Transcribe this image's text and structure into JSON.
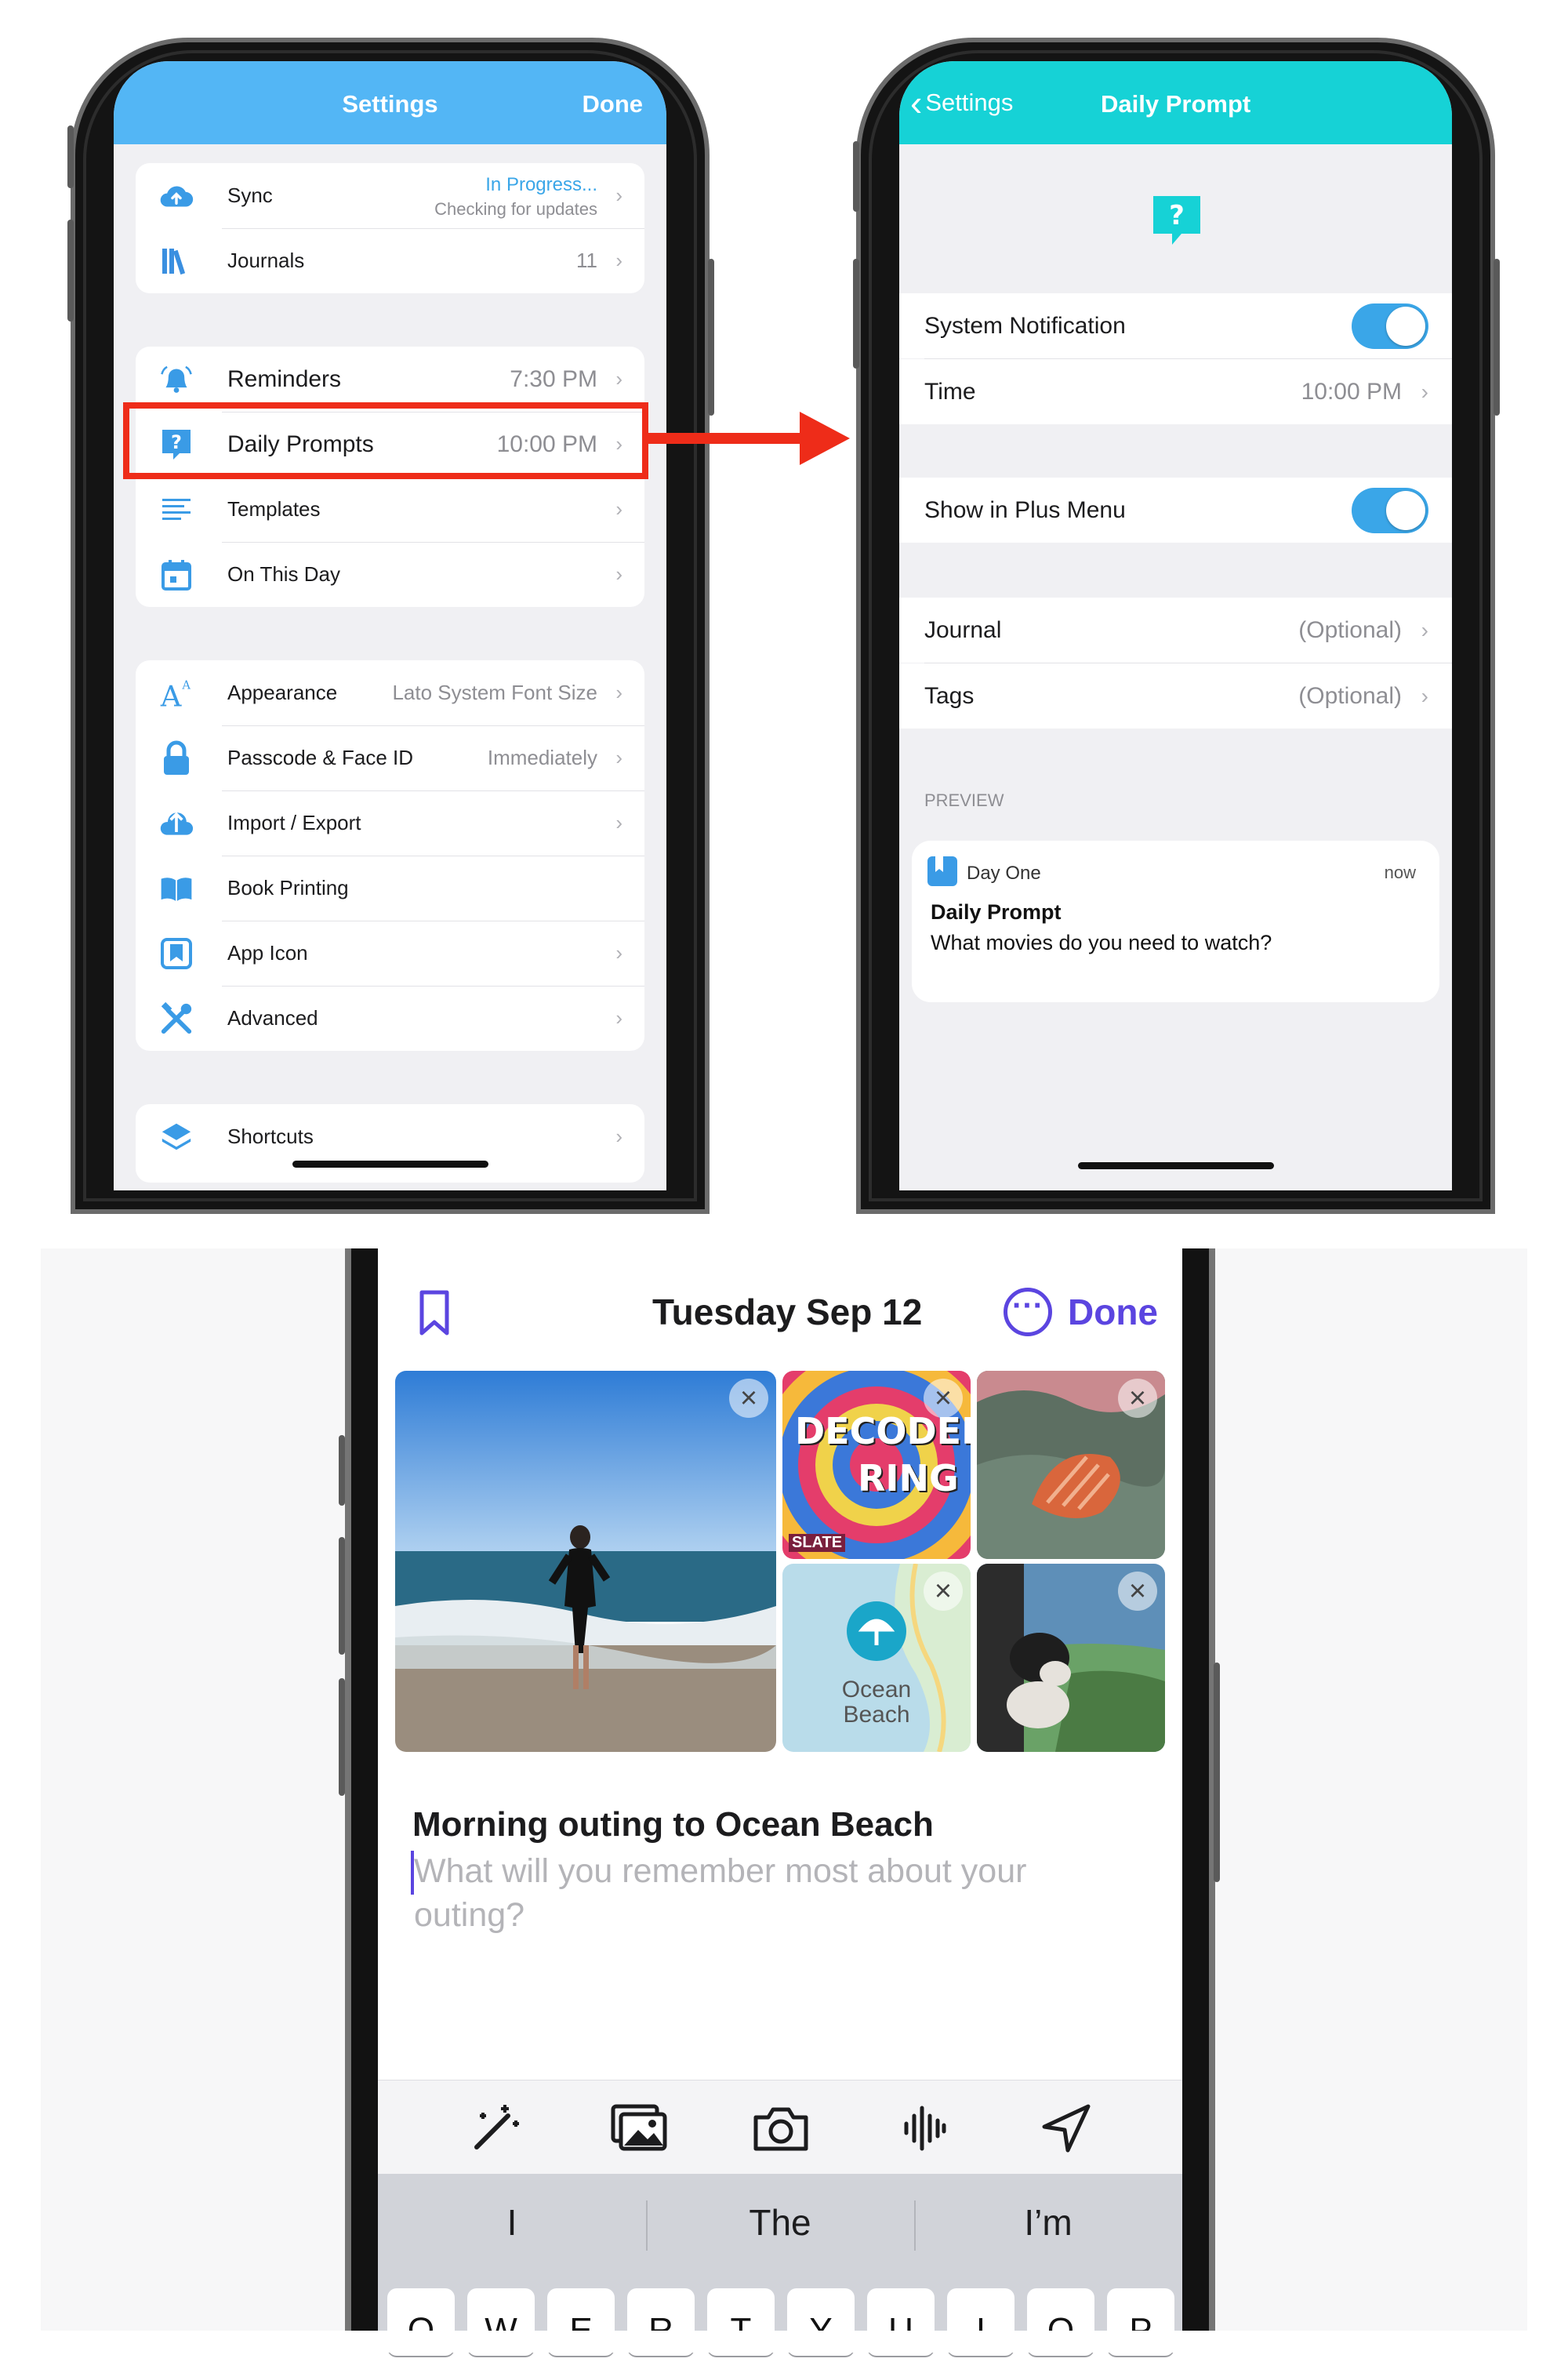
{
  "colors": {
    "settings_header": "#53b6f5",
    "prompt_header": "#16d2d6",
    "highlight": "#ee2c19",
    "toggle": "#3aa6e8",
    "accent_purple": "#5b45e0"
  },
  "settings_screen": {
    "title": "Settings",
    "done": "Done",
    "group1": [
      {
        "icon": "cloud-upload-icon",
        "label": "Sync",
        "status": "In Progress...",
        "detail": "Checking for updates"
      },
      {
        "icon": "books-icon",
        "label": "Journals",
        "value": "11"
      }
    ],
    "group2": [
      {
        "icon": "bell-icon",
        "label": "Reminders",
        "value": "7:30 PM"
      },
      {
        "icon": "question-bubble-icon",
        "label": "Daily Prompts",
        "value": "10:00 PM"
      },
      {
        "icon": "lines-icon",
        "label": "Templates",
        "value": ""
      },
      {
        "icon": "calendar-icon",
        "label": "On This Day",
        "value": ""
      }
    ],
    "group3": [
      {
        "icon": "font-size-icon",
        "label": "Appearance",
        "value": "Lato System Font Size"
      },
      {
        "icon": "lock-icon",
        "label": "Passcode & Face ID",
        "value": "Immediately"
      },
      {
        "icon": "import-export-icon",
        "label": "Import / Export",
        "value": ""
      },
      {
        "icon": "book-icon",
        "label": "Book Printing",
        "value": ""
      },
      {
        "icon": "bookmark-square-icon",
        "label": "App Icon",
        "value": ""
      },
      {
        "icon": "tools-icon",
        "label": "Advanced",
        "value": ""
      }
    ],
    "group4": [
      {
        "icon": "shortcuts-icon",
        "label": "Shortcuts",
        "value": ""
      }
    ]
  },
  "prompt_screen": {
    "back": "Settings",
    "title": "Daily Prompt",
    "system_notification": "System Notification",
    "time_label": "Time",
    "time_value": "10:00 PM",
    "show_in_plus": "Show in Plus Menu",
    "journal_label": "Journal",
    "journal_value": "(Optional)",
    "tags_label": "Tags",
    "tags_value": "(Optional)",
    "preview_header": "PREVIEW",
    "preview": {
      "app": "Day One",
      "time": "now",
      "title": "Daily Prompt",
      "body": "What movies do you need to watch?"
    }
  },
  "entry_screen": {
    "date": "Tuesday Sep 12",
    "done": "Done",
    "photo_text": {
      "podcast_line1": "DECODER",
      "podcast_line2": "RING",
      "podcast_brand": "SLATE",
      "map_line1": "Ocean",
      "map_line2": "Beach"
    },
    "entry_title": "Morning outing to Ocean Beach",
    "prompt_placeholder": "What will you remember most about your outing?",
    "suggestions": [
      "I",
      "The",
      "I’m"
    ],
    "keyboard_row": [
      "Q",
      "W",
      "E",
      "R",
      "T",
      "Y",
      "U",
      "I",
      "O",
      "P"
    ]
  }
}
